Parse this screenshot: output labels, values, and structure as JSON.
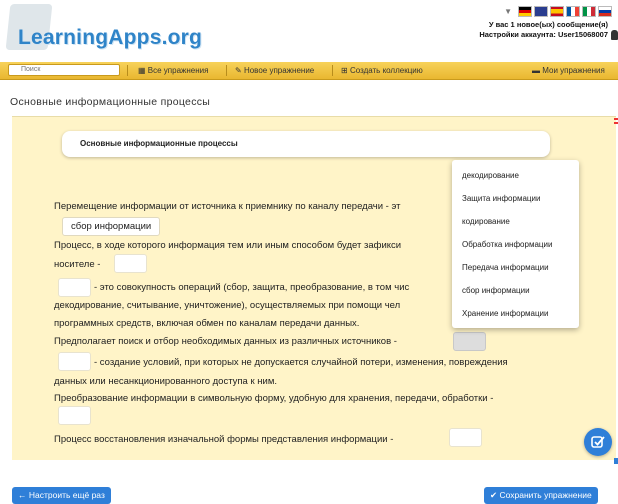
{
  "header": {
    "logo_text": "LearningApps.org",
    "messages": "У вас 1 новое(ых) сообщение(я)",
    "account": "Настройки аккаунта: User15068007"
  },
  "nav": {
    "search_placeholder": "Поиск",
    "all_exercises": "Все упражнения",
    "new_exercise": "Новое упражнение",
    "create_collection": "Создать коллекцию",
    "my_exercises": "Мои упражнения"
  },
  "page_title": "Основные информационные процессы",
  "exercise": {
    "title": "Основные информационные процессы",
    "lines": [
      "Перемещение информации от источника к приемнику по каналу передачи - эт",
      "Процесс, в ходе которого информация тем или иным способом будет зафикси",
      "носителе -",
      "- это совокупность операций (сбор, защита, преобразование, в том чис",
      "декодирование, считывание, уничтожение), осуществляемых при помощи чел",
      "программных средств, включая обмен по каналам передачи данных.",
      "Предполагает поиск и отбор необходимых данных из различных источников -",
      "- создание условий, при которых не допускается случайной потери, изменения, повреждения",
      "данных или несанкционированного доступа к ним.",
      "Преобразование информации в символьную форму, удобную для хранения, передачи, обработки -",
      "Процесс восстановления изначальной формы представления информации -"
    ],
    "filled_answer": "сбор информации"
  },
  "dropdown": {
    "options": [
      "декодирование",
      "Защита информации",
      "кодирование",
      "Обработка информации",
      "Передача информации",
      "сбор информации",
      "Хранение информации"
    ]
  },
  "buttons": {
    "reset": "Настроить ещё раз",
    "save": "Сохранить упражнение"
  },
  "colors": {
    "nav_yellow": "#f0c443",
    "exercise_bg": "#fff4c8",
    "accent_blue": "#2f7fd8",
    "logo_blue": "#2f84c8"
  }
}
